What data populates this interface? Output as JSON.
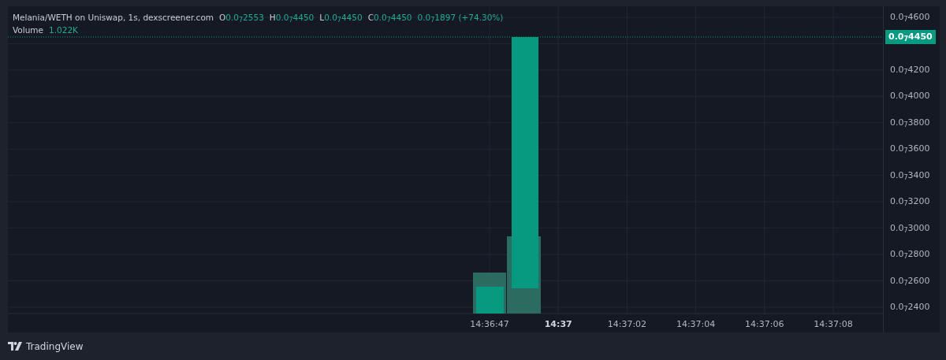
{
  "legend": {
    "title": "Melania/WETH on Uniswap, 1s, dexscreener.com",
    "fields": [
      {
        "label": "O",
        "value": "0.0$_{7}$2553"
      },
      {
        "label": "H",
        "value": "0.0$_{7}$4450"
      },
      {
        "label": "L",
        "value": "0.0$_{7}$4450"
      },
      {
        "label": "C",
        "value": "0.0$_{7}$4450"
      }
    ],
    "change": "0.0$_{7}$1897 (+74.30%)",
    "volume": {
      "label": "Volume",
      "value": "1.022K"
    }
  },
  "price_axis": {
    "labels": [
      "0.0$_{7}$4600",
      "0.0$_{7}$4200",
      "0.0$_{7}$4000",
      "0.0$_{7}$3800",
      "0.0$_{7}$3600",
      "0.0$_{7}$3400",
      "0.0$_{7}$3200",
      "0.0$_{7}$3000",
      "0.0$_{7}$2800",
      "0.0$_{7}$2600",
      "0.0$_{7}$2400"
    ],
    "last_price": "0.0$_{7}$4450"
  },
  "time_axis": {
    "labels": [
      {
        "text": "14:36:47",
        "major": false
      },
      {
        "text": "14:37",
        "major": true
      },
      {
        "text": "14:37:02",
        "major": false
      },
      {
        "text": "14:37:04",
        "major": false
      },
      {
        "text": "14:37:06",
        "major": false
      },
      {
        "text": "14:37:08",
        "major": false
      }
    ]
  },
  "footer": {
    "brand": "TradingView"
  }
}
